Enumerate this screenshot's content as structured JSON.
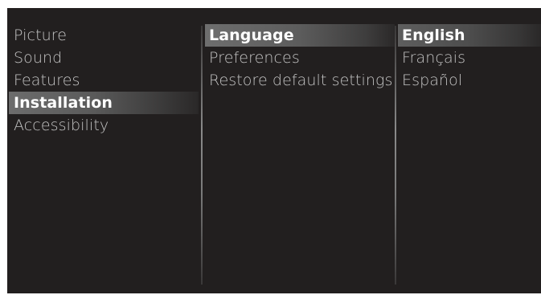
{
  "menu": {
    "main": [
      {
        "label": "Picture",
        "selected": false
      },
      {
        "label": "Sound",
        "selected": false
      },
      {
        "label": "Features",
        "selected": false
      },
      {
        "label": "Installation",
        "selected": true
      },
      {
        "label": "Accessibility",
        "selected": false
      }
    ],
    "installation": [
      {
        "label": "Language",
        "selected": true
      },
      {
        "label": "Preferences",
        "selected": false
      },
      {
        "label": "Restore default settings",
        "selected": false
      }
    ],
    "language": [
      {
        "label": "English",
        "selected": true
      },
      {
        "label": "Français",
        "selected": false
      },
      {
        "label": "Español",
        "selected": false
      }
    ]
  },
  "colors": {
    "background": "#221f1f",
    "text": "#c4c4c4",
    "highlight_text": "#ffffff",
    "highlight": "#6c6c6c"
  }
}
